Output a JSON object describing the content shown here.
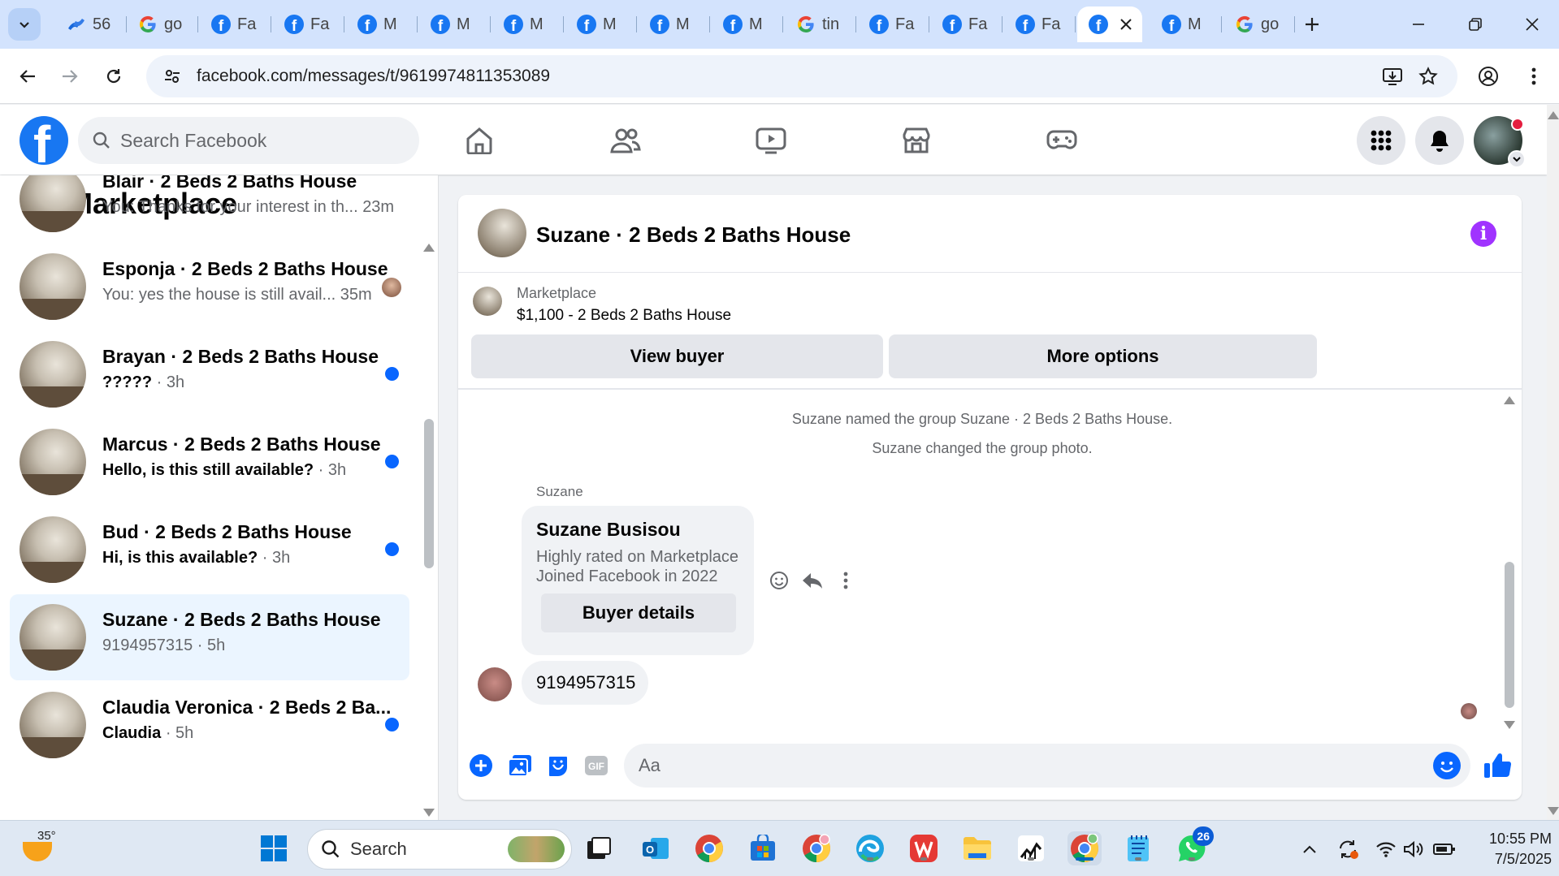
{
  "browser": {
    "tabs": [
      {
        "icon": "confluence-icon",
        "title": "56"
      },
      {
        "icon": "google-icon",
        "title": "go"
      },
      {
        "icon": "facebook-icon",
        "title": "Fa"
      },
      {
        "icon": "facebook-icon",
        "title": "Fa"
      },
      {
        "icon": "facebook-icon",
        "title": "M"
      },
      {
        "icon": "facebook-icon",
        "title": "M"
      },
      {
        "icon": "facebook-icon",
        "title": "M"
      },
      {
        "icon": "facebook-icon",
        "title": "M"
      },
      {
        "icon": "facebook-icon",
        "title": "M"
      },
      {
        "icon": "facebook-icon",
        "title": "M"
      },
      {
        "icon": "google-icon",
        "title": "tin"
      },
      {
        "icon": "facebook-icon",
        "title": "Fa"
      },
      {
        "icon": "facebook-icon",
        "title": "Fa"
      },
      {
        "icon": "facebook-icon",
        "title": "Fa"
      },
      {
        "icon": "facebook-icon",
        "title": "",
        "active": true
      },
      {
        "icon": "facebook-icon",
        "title": "M"
      },
      {
        "icon": "google-icon",
        "title": "go"
      }
    ],
    "url": "facebook.com/messages/t/9619974811353089"
  },
  "facebook": {
    "search_placeholder": "Search Facebook",
    "brand_color": "#1877f2"
  },
  "sidebar": {
    "title": "Marketplace",
    "conversations": [
      {
        "name": "Blair · 2 Beds 2 Baths House",
        "preview": "You: Thanks for your interest in th...",
        "time": "23m",
        "unread": false,
        "status": "none"
      },
      {
        "name": "Esponja · 2 Beds 2 Baths House",
        "preview": "You: yes the house is still avail...",
        "time": "35m",
        "unread": false,
        "status": "seen"
      },
      {
        "name": "Brayan · 2 Beds 2 Baths House",
        "preview": "?????",
        "time": "· 3h",
        "unread": true,
        "status": "unread"
      },
      {
        "name": "Marcus · 2 Beds 2 Baths House",
        "preview": "Hello, is this still available?",
        "time": "· 3h",
        "unread": true,
        "status": "unread"
      },
      {
        "name": "Bud · 2 Beds 2 Baths House",
        "preview": "Hi, is this available?",
        "time": "· 3h",
        "unread": true,
        "status": "unread"
      },
      {
        "name": "Suzane · 2 Beds 2 Baths House",
        "preview": "9194957315",
        "time": "· 5h",
        "unread": false,
        "status": "none",
        "active": true
      },
      {
        "name": "Claudia Veronica · 2 Beds 2 Ba...",
        "preview": "Claudia",
        "time": "· 5h",
        "unread": true,
        "status": "unread"
      }
    ]
  },
  "chat": {
    "title": "Suzane · 2 Beds 2 Baths House",
    "listing": {
      "label": "Marketplace",
      "detail": "$1,100 - 2 Beds 2 Baths House",
      "view_buyer": "View buyer",
      "more_options": "More options"
    },
    "system_messages": [
      "Suzane named the group Suzane · 2 Beds 2 Baths House.",
      "Suzane changed the group photo."
    ],
    "sender": "Suzane",
    "card": {
      "name": "Suzane Busisou",
      "line1": "Highly rated on Marketplace",
      "line2": "Joined Facebook in 2022",
      "button": "Buyer details"
    },
    "phone_message": "9194957315",
    "composer_placeholder": "Aa",
    "gif_label": "GIF"
  },
  "taskbar": {
    "temperature": "35°",
    "search_placeholder": "Search",
    "whatsapp_badge": "26",
    "time": "10:55 PM",
    "date": "7/5/2025"
  }
}
